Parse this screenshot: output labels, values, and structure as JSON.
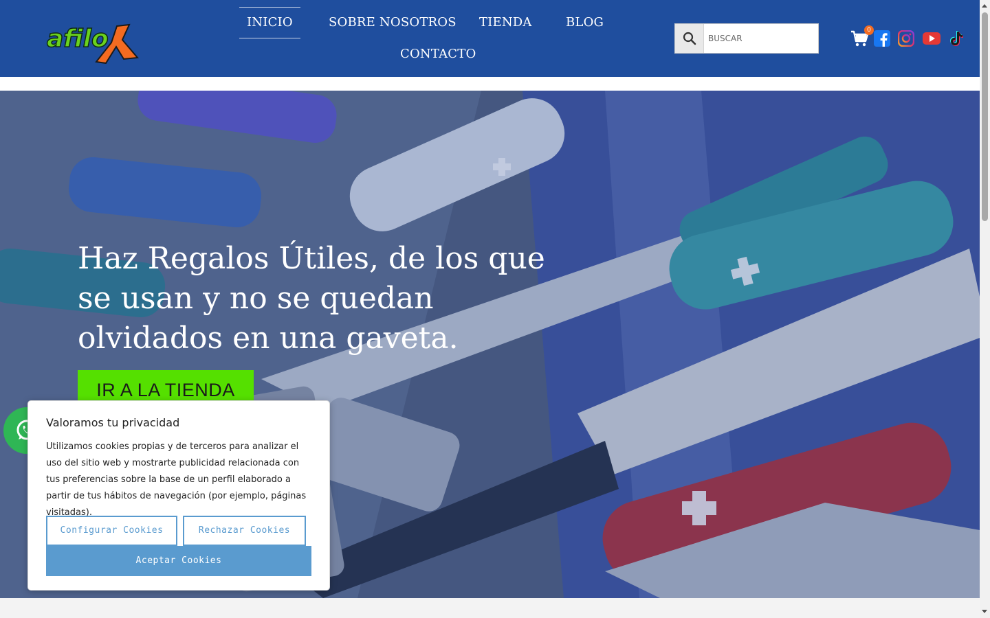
{
  "brand": {
    "name": "afilox"
  },
  "nav": {
    "items": [
      {
        "label": "INICIO",
        "active": true
      },
      {
        "label": "SOBRE NOSOTROS",
        "active": false
      },
      {
        "label": "TIENDA",
        "active": false
      },
      {
        "label": "BLOG",
        "active": false
      },
      {
        "label": "CONTACTO",
        "active": false
      }
    ]
  },
  "search": {
    "placeholder": "BUSCAR",
    "value": ""
  },
  "cart": {
    "count": "0"
  },
  "social": [
    "facebook-icon",
    "instagram-icon",
    "youtube-icon",
    "tiktok-icon"
  ],
  "hero": {
    "title": "Haz Regalos Útiles, de los que se usan y no se quedan olvidados en una gaveta.",
    "cta_label": "IR A LA TIENDA"
  },
  "cookie": {
    "title": "Valoramos tu privacidad",
    "text": "Utilizamos cookies propias y de terceros para analizar el uso del sitio web y mostrarte publicidad relacionada con tus preferencias sobre la base de un perfil elaborado a partir de tus hábitos de navegación (por ejemplo, páginas visitadas).",
    "configure_label": "Configurar Cookies",
    "reject_label": "Rechazar Cookies",
    "accept_label": "Aceptar Cookies"
  },
  "colors": {
    "header_bg": "#1f4e9e",
    "cta_bg": "#55e000",
    "cookie_accent": "#5a9bcf",
    "whatsapp": "#2fb655",
    "badge": "#f36b21"
  }
}
